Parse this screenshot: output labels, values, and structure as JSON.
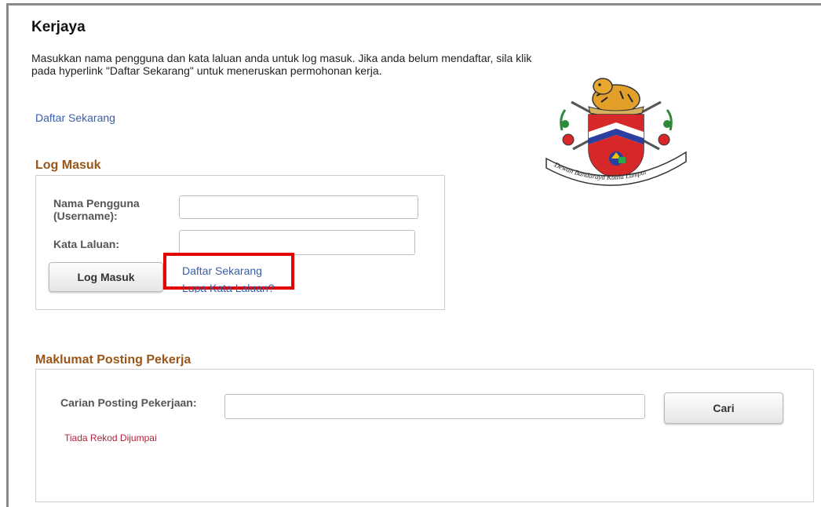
{
  "page": {
    "title": "Kerjaya",
    "intro": "Masukkan nama pengguna dan kata laluan anda untuk log masuk. Jika anda belum mendaftar, sila klik pada hyperlink \"Daftar Sekarang\" untuk meneruskan permohonan kerja.",
    "register_link": "Daftar Sekarang"
  },
  "emblem": {
    "ribbon_text": "Dewan Bandaraya Kuala Lumpur"
  },
  "login": {
    "section_title": "Log Masuk",
    "username_label": "Nama Pengguna (Username):",
    "username_value": "",
    "password_label": "Kata Laluan:",
    "password_value": "",
    "submit_label": "Log Masuk",
    "register_link": "Daftar Sekarang",
    "forgot_link": "Lupa Kata Laluan?"
  },
  "posting": {
    "section_title": "Maklumat Posting Pekerja",
    "search_label": "Carian Posting Pekerjaan:",
    "search_value": "",
    "search_button": "Cari",
    "no_record": "Tiada Rekod Dijumpai"
  },
  "colors": {
    "section_title": "#9a5518",
    "link": "#3a5ea8",
    "no_record": "#b0243a",
    "highlight": "#e30000"
  }
}
